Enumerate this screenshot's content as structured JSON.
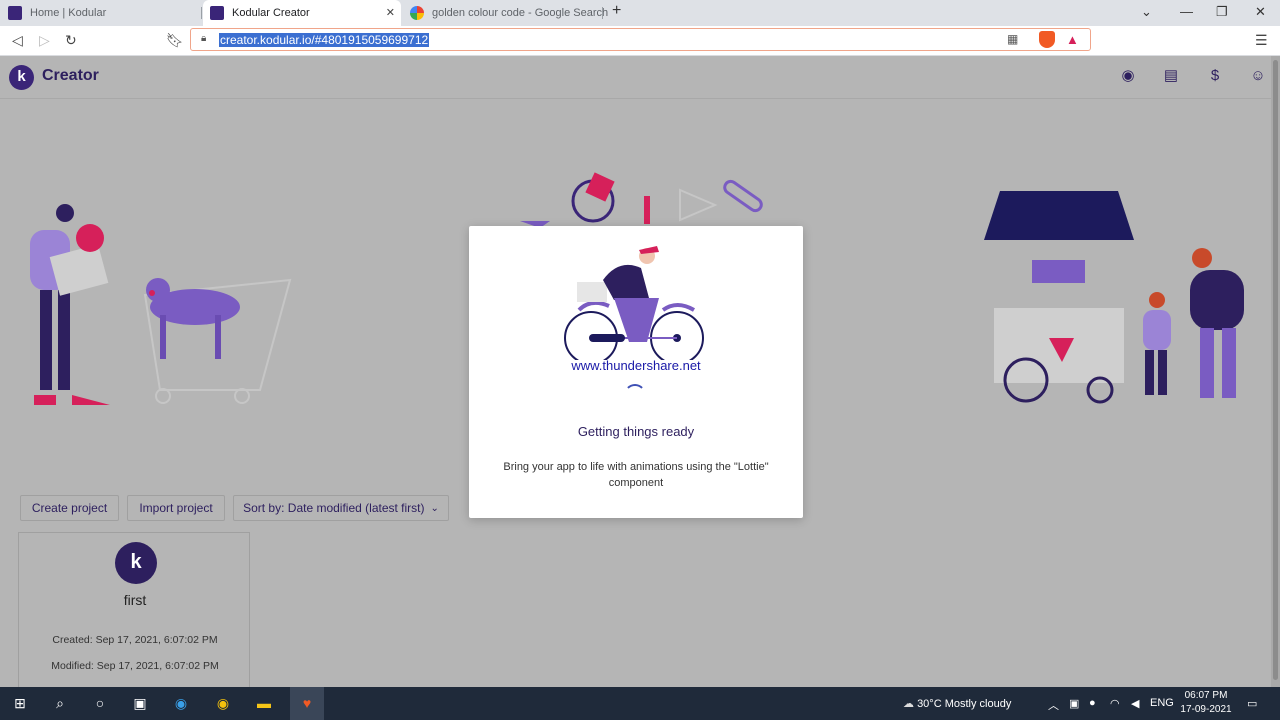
{
  "browser": {
    "tabs": [
      {
        "title": "Home | Kodular",
        "active": false
      },
      {
        "title": "Kodular Creator",
        "active": true
      },
      {
        "title": "golden colour code - Google Search",
        "active": false
      }
    ],
    "url": "creator.kodular.io/#4801915059699712"
  },
  "app": {
    "brand": "Creator",
    "logo_letter": "k",
    "buttons": {
      "create": "Create project",
      "import": "Import project",
      "sort": "Sort by: Date modified (latest first)"
    },
    "project": {
      "avatar_letter": "k",
      "name": "first",
      "created": "Created: Sep 17, 2021, 6:07:02 PM",
      "modified": "Modified: Sep 17, 2021, 6:07:02 PM"
    }
  },
  "modal": {
    "watermark": "www.thundershare.net",
    "title": "Getting things ready",
    "text": "Bring your app to life with animations using the \"Lottie\" component"
  },
  "taskbar": {
    "weather": "30°C  Mostly cloudy",
    "lang": "ENG",
    "time": "06:07 PM",
    "date": "17-09-2021"
  },
  "colors": {
    "brand": "#2d1f5e",
    "accent": "#d6205a",
    "overlay_bg": "#b5b5b5",
    "purple": "#7a5cc2"
  }
}
